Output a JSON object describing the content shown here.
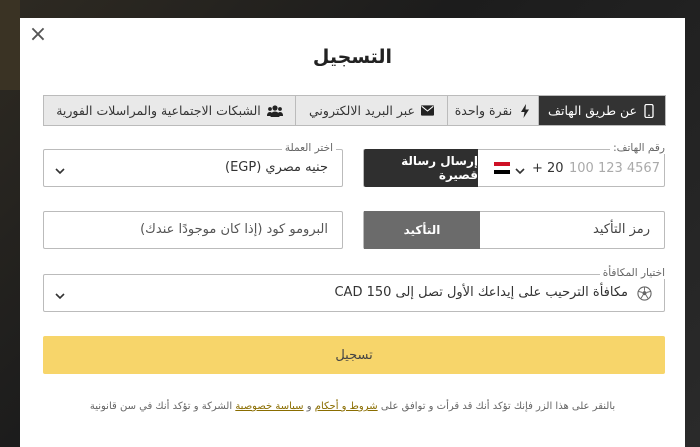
{
  "modal": {
    "title": "التسجيل",
    "close_glyph": "×"
  },
  "tabs": [
    {
      "label": "عن طريق الهاتف",
      "icon": "mobile-icon",
      "active": true
    },
    {
      "label": "نقرة واحدة",
      "icon": "bolt-icon",
      "active": false
    },
    {
      "label": "عبر البريد الالكتروني",
      "icon": "envelope-icon",
      "active": false
    },
    {
      "label": "الشبكات الاجتماعية والمراسلات الفورية",
      "icon": "users-icon",
      "active": false
    }
  ],
  "phone": {
    "label": "رقم الهاتف:",
    "placeholder": "100 123 4567",
    "country_code": "+ 20",
    "send_sms_label": "إرسال رسالة قصيرة"
  },
  "currency": {
    "label": "اختر العملة",
    "value": "جنيه مصري (EGP)"
  },
  "confirmation": {
    "placeholder": "رمز التأكيد",
    "confirm_label": "التأكيد"
  },
  "promo": {
    "placeholder": "البرومو كود (إذا كان موجودًا عندك)"
  },
  "bonus": {
    "label": "اختيار المكافأة",
    "value": "مكافأة الترحيب على إيداعك الأول تصل إلى 150 CAD"
  },
  "register_label": "تسجيل",
  "terms": {
    "part1": "بالنقر على هذا الزر فإنك تؤكد أنك قد قرأت و توافق على ",
    "terms_link": "شروط و أحكام",
    "part2": " و ",
    "privacy_link": "سياسة خصوصية",
    "part3": " الشركة و تؤكد أنك في سن قانونية"
  },
  "colors": {
    "active_tab": "#333333",
    "register_button": "#f7d56a",
    "send_sms_button": "#2f2f2f",
    "confirm_button": "#6b6b6b"
  }
}
